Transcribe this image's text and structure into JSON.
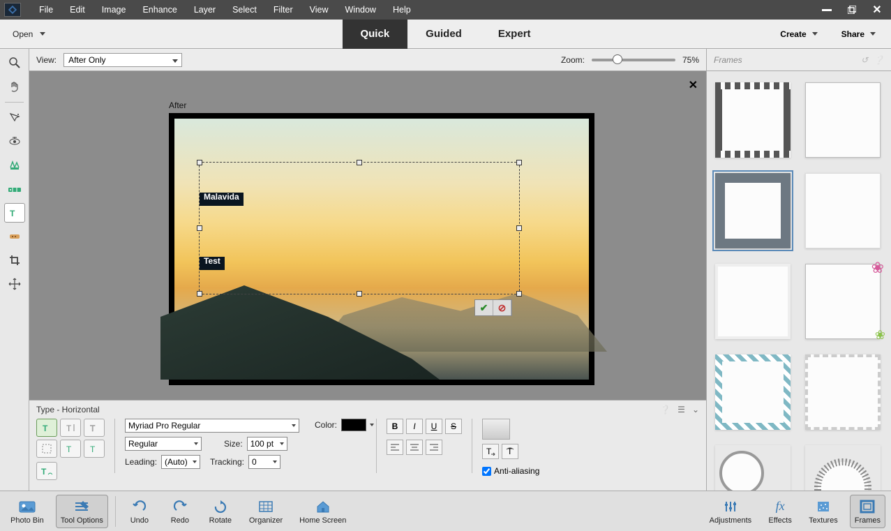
{
  "menu": {
    "items": [
      "File",
      "Edit",
      "Image",
      "Enhance",
      "Layer",
      "Select",
      "Filter",
      "View",
      "Window",
      "Help"
    ]
  },
  "modebar": {
    "open": "Open",
    "modes": [
      "Quick",
      "Guided",
      "Expert"
    ],
    "active": "Quick",
    "create": "Create",
    "share": "Share"
  },
  "viewbar": {
    "label": "View:",
    "viewmode": "After Only",
    "zoom_label": "Zoom:",
    "zoom_value": "75%"
  },
  "canvas": {
    "afterlabel": "After",
    "text_line1": "Malavida",
    "text_line2": "Test"
  },
  "rightpanel": {
    "title": "Frames"
  },
  "options": {
    "title": "Type - Horizontal",
    "font": "Myriad Pro Regular",
    "style": "Regular",
    "size_label": "Size:",
    "size": "100 pt",
    "leading_label": "Leading:",
    "leading": "(Auto)",
    "tracking_label": "Tracking:",
    "tracking": "0",
    "color_label": "Color:",
    "bold": "B",
    "italic": "I",
    "underline": "U",
    "strike": "S",
    "antialias": "Anti-aliasing"
  },
  "bottom": {
    "photobin": "Photo Bin",
    "toolopts": "Tool Options",
    "undo": "Undo",
    "redo": "Redo",
    "rotate": "Rotate",
    "organizer": "Organizer",
    "home": "Home Screen",
    "adjustments": "Adjustments",
    "effects": "Effects",
    "textures": "Textures",
    "frames": "Frames"
  }
}
